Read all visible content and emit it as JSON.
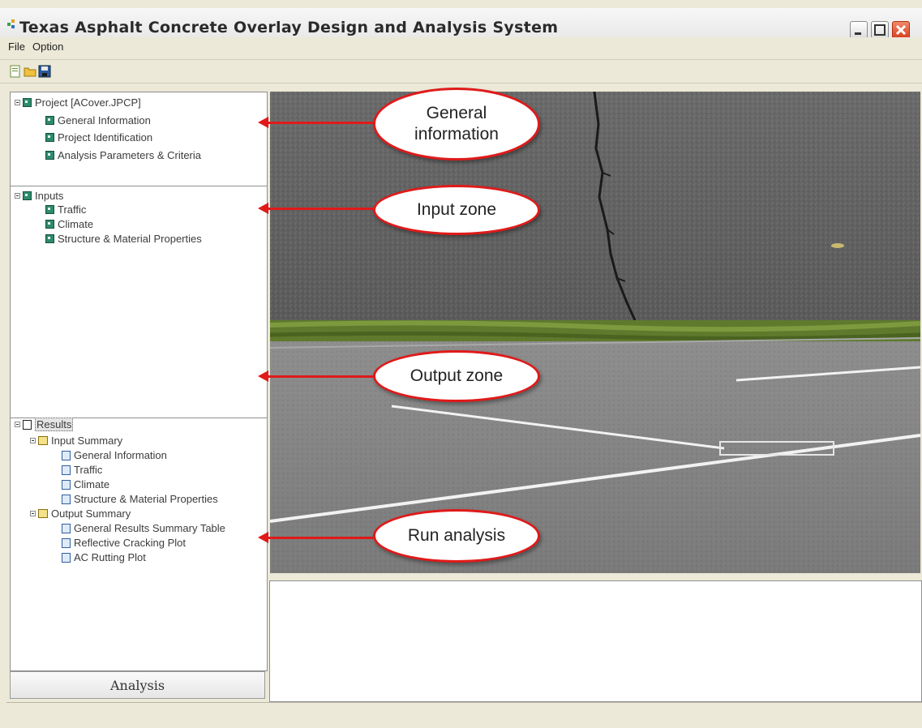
{
  "window": {
    "title": "Texas Asphalt Concrete Overlay Design and Analysis System"
  },
  "menu": {
    "items": [
      "File",
      "Option"
    ]
  },
  "project_tree": {
    "root_label": "Project [ACover.JPCP]",
    "items": [
      "General Information",
      "Project Identification",
      "Analysis Parameters & Criteria"
    ]
  },
  "inputs_tree": {
    "root_label": "Inputs",
    "items": [
      "Traffic",
      "Climate",
      "Structure & Material Properties"
    ]
  },
  "results_tree": {
    "root_label": "Results",
    "input_summary": {
      "label": "Input Summary",
      "items": [
        "General Information",
        "Traffic",
        "Climate",
        "Structure & Material Properties"
      ]
    },
    "output_summary": {
      "label": "Output Summary",
      "items": [
        "General Results Summary Table",
        "Reflective Cracking Plot",
        "AC Rutting Plot"
      ]
    }
  },
  "analysis_button": "Analysis",
  "callouts": {
    "general": "General information",
    "input": "Input zone",
    "output": "Output zone",
    "run": "Run analysis"
  },
  "colors": {
    "callout_red": "#e01a1a",
    "window_bg": "#ece9d8"
  }
}
